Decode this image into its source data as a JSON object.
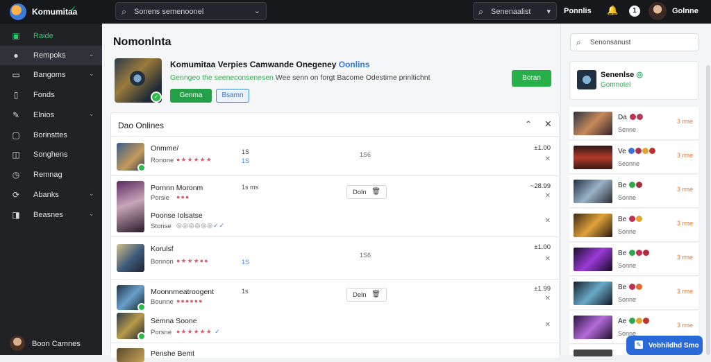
{
  "topbar": {
    "brand": "Komumitaa",
    "search_placeholder": "Sonens semenoonel",
    "search2_placeholder": "Senenaalist",
    "link": "Ponnlis",
    "notif": "1",
    "username": "Golnne"
  },
  "sidebar": {
    "items": [
      {
        "label": "Raide",
        "icon": "home-icon"
      },
      {
        "label": "Rempoks",
        "icon": "user-icon"
      },
      {
        "label": "Bangoms",
        "icon": "grid-icon"
      },
      {
        "label": "Fonds",
        "icon": "doc-icon"
      },
      {
        "label": "Elnios",
        "icon": "pen-icon"
      },
      {
        "label": "Borinsttes",
        "icon": "chat-icon"
      },
      {
        "label": "Songhens",
        "icon": "box-icon"
      },
      {
        "label": "Remnag",
        "icon": "clock-icon"
      },
      {
        "label": "Abanks",
        "icon": "sync-icon"
      },
      {
        "label": "Beasnes",
        "icon": "bag-icon"
      }
    ],
    "user_name": "Boon Camnes"
  },
  "main": {
    "title": "Nomonlnta",
    "hero": {
      "title": "Komumitaa Verpies Camwande Onegeney",
      "title_link": "Oonlins",
      "desc_green": "Genngeo the seeneconsenesen",
      "desc": "Wee senn on forgt Bacome Odestime prinltichnt",
      "btn_primary": "Genma",
      "btn_secondary": "Bsamn",
      "btn_join": "Boran"
    },
    "panel": {
      "title": "Dao Onlines"
    },
    "rows": [
      {
        "name": "Onmme/",
        "sub": "Ronone",
        "mid": "1S",
        "midb": "1S",
        "chip": "1S6",
        "num": "±1.00"
      },
      {
        "name": "Pornnn Moronm",
        "mid": "1s ms",
        "sub": "Porsie",
        "name2": "Poonse Iolsatse",
        "sub2": "Stonse",
        "num": "~28.99",
        "btn": "Doln"
      },
      {
        "name": "Korulsf",
        "sub": "Bonnon",
        "midb": "1S",
        "chip": "1S6",
        "num": "±1.00"
      },
      {
        "name": "Moonnmeatroogent",
        "mid": "1s",
        "sub": "Bounne",
        "name2": "Semna Soone",
        "sub2": "Porsne",
        "num": "±1.99",
        "btn": "Deln"
      },
      {
        "name": "Penshe Bemt"
      }
    ]
  },
  "right": {
    "search_placeholder": "Senonsanust",
    "profile": {
      "name": "Senenlse",
      "status": "Gomnotel"
    },
    "items": [
      {
        "title": "Da",
        "sub": "Senne",
        "price": "3 rme"
      },
      {
        "title": "Ve",
        "sub": "Seonne",
        "price": "3 rme"
      },
      {
        "title": "Be",
        "sub": "Sonne",
        "price": "3 rme"
      },
      {
        "title": "Be",
        "sub": "Sonne",
        "price": "3 rme"
      },
      {
        "title": "Be",
        "sub": "Sonne",
        "price": "3 rme"
      },
      {
        "title": "Be",
        "sub": "Sonne",
        "price": "3 rme"
      },
      {
        "title": "Ae",
        "sub": "Sonne",
        "price": "3 rme"
      }
    ],
    "cta": "Vobhildhd Smo"
  },
  "colors": {
    "accent": "#2ecc71",
    "link": "#3f86e0",
    "sidebar": "#202226",
    "topbar": "#16181c"
  }
}
